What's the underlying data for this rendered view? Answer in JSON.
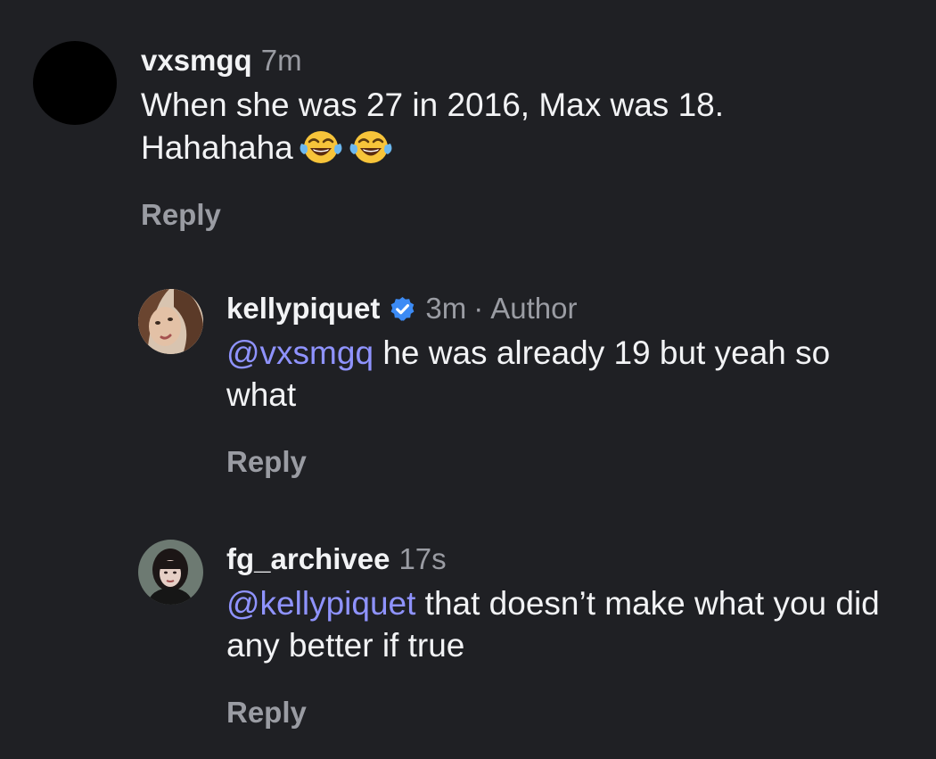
{
  "comments": [
    {
      "username": "vxsmgq",
      "time": "7m",
      "text": "When she was 27 in 2016, Max was 18. Hahahaha",
      "emoji_count": 2,
      "emoji_icon": "face-with-tears-of-joy-icon",
      "reply_label": "Reply"
    },
    {
      "username": "kellypiquet",
      "verified": true,
      "time": "3m",
      "separator": "·",
      "badge": "Author",
      "mention": "@vxsmgq",
      "text": " he was already 19 but yeah so what",
      "reply_label": "Reply"
    },
    {
      "username": "fg_archivee",
      "time": "17s",
      "mention": "@kellypiquet",
      "text": " that doesn’t make what you did any better if true",
      "reply_label": "Reply"
    }
  ],
  "colors": {
    "background": "#1f2024",
    "text": "#f2f3f5",
    "muted": "#9a9ca3",
    "mention": "#8f93ff",
    "verified": "#3c8bf5"
  }
}
